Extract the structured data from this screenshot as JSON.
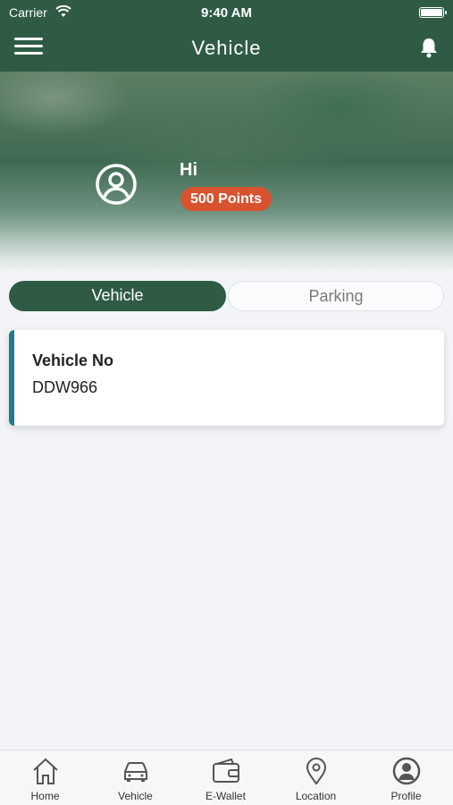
{
  "status_bar": {
    "carrier": "Carrier",
    "time": "9:40 AM"
  },
  "nav": {
    "title": "Vehicle"
  },
  "profile": {
    "greeting": "Hi",
    "points": "500 Points"
  },
  "tabs": [
    {
      "label": "Vehicle",
      "active": true
    },
    {
      "label": "Parking",
      "active": false
    }
  ],
  "vehicle_card": {
    "label": "Vehicle No",
    "value": "DDW966"
  },
  "bottom_nav": [
    {
      "label": "Home",
      "icon": "home-icon"
    },
    {
      "label": "Vehicle",
      "icon": "car-icon"
    },
    {
      "label": "E-Wallet",
      "icon": "wallet-icon"
    },
    {
      "label": "Location",
      "icon": "location-pin-icon"
    },
    {
      "label": "Profile",
      "icon": "profile-icon"
    }
  ],
  "colors": {
    "primary": "#2f5b45",
    "badge": "#d7532f",
    "card_accent": "#1e7d8a"
  }
}
